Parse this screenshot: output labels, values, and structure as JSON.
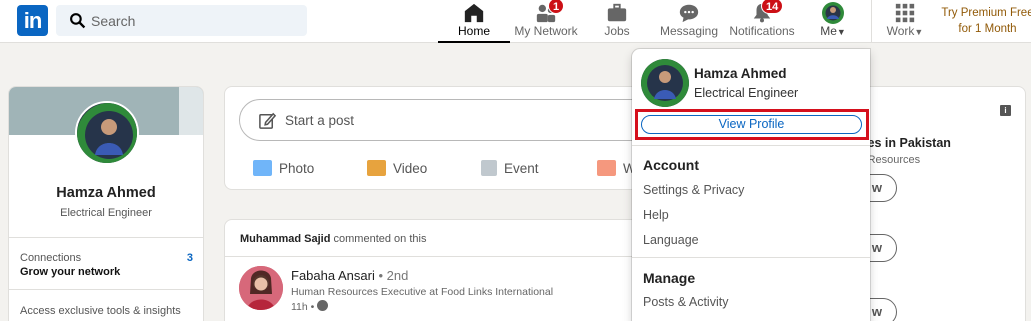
{
  "nav": {
    "logo": "in",
    "search_placeholder": "Search",
    "items": [
      {
        "label": "Home",
        "icon": "home-icon"
      },
      {
        "label": "My Network",
        "icon": "network-icon",
        "badge": "1"
      },
      {
        "label": "Jobs",
        "icon": "briefcase-icon"
      },
      {
        "label": "Messaging",
        "icon": "messaging-icon"
      },
      {
        "label": "Notifications",
        "icon": "bell-icon",
        "badge": "14"
      },
      {
        "label": "Me",
        "icon": "avatar-icon"
      },
      {
        "label": "Work",
        "icon": "grid-icon"
      }
    ],
    "premium": "Try Premium Free for 1 Month"
  },
  "profile": {
    "name": "Hamza Ahmed",
    "title": "Electrical Engineer",
    "connections_label": "Connections",
    "connections_count": "3",
    "grow": "Grow your network",
    "access": "Access exclusive tools & insights"
  },
  "post": {
    "start": "Start a post",
    "actions": [
      "Photo",
      "Video",
      "Event",
      "W"
    ]
  },
  "feed": {
    "commenter": "Muhammad Sajid",
    "action": "commented on this",
    "author": "Fabaha Ansari",
    "degree": "• 2nd",
    "headline": "Human Resources Executive at Food Links International",
    "time": "11h •"
  },
  "right": {
    "t1": "tunities in Pakistan",
    "t2": "uman Resources",
    "btn": "w",
    "t3": "s",
    "info": "i"
  },
  "dropdown": {
    "name": "Hamza Ahmed",
    "title": "Electrical Engineer",
    "view_profile": "View Profile",
    "account_header": "Account",
    "account_items": [
      "Settings & Privacy",
      "Help",
      "Language"
    ],
    "manage_header": "Manage",
    "manage_items": [
      "Posts & Activity"
    ]
  },
  "colors": {
    "brand": "#0a66c2",
    "badge": "#cc1016",
    "highlight": "#d5101d",
    "premium": "#915907"
  }
}
